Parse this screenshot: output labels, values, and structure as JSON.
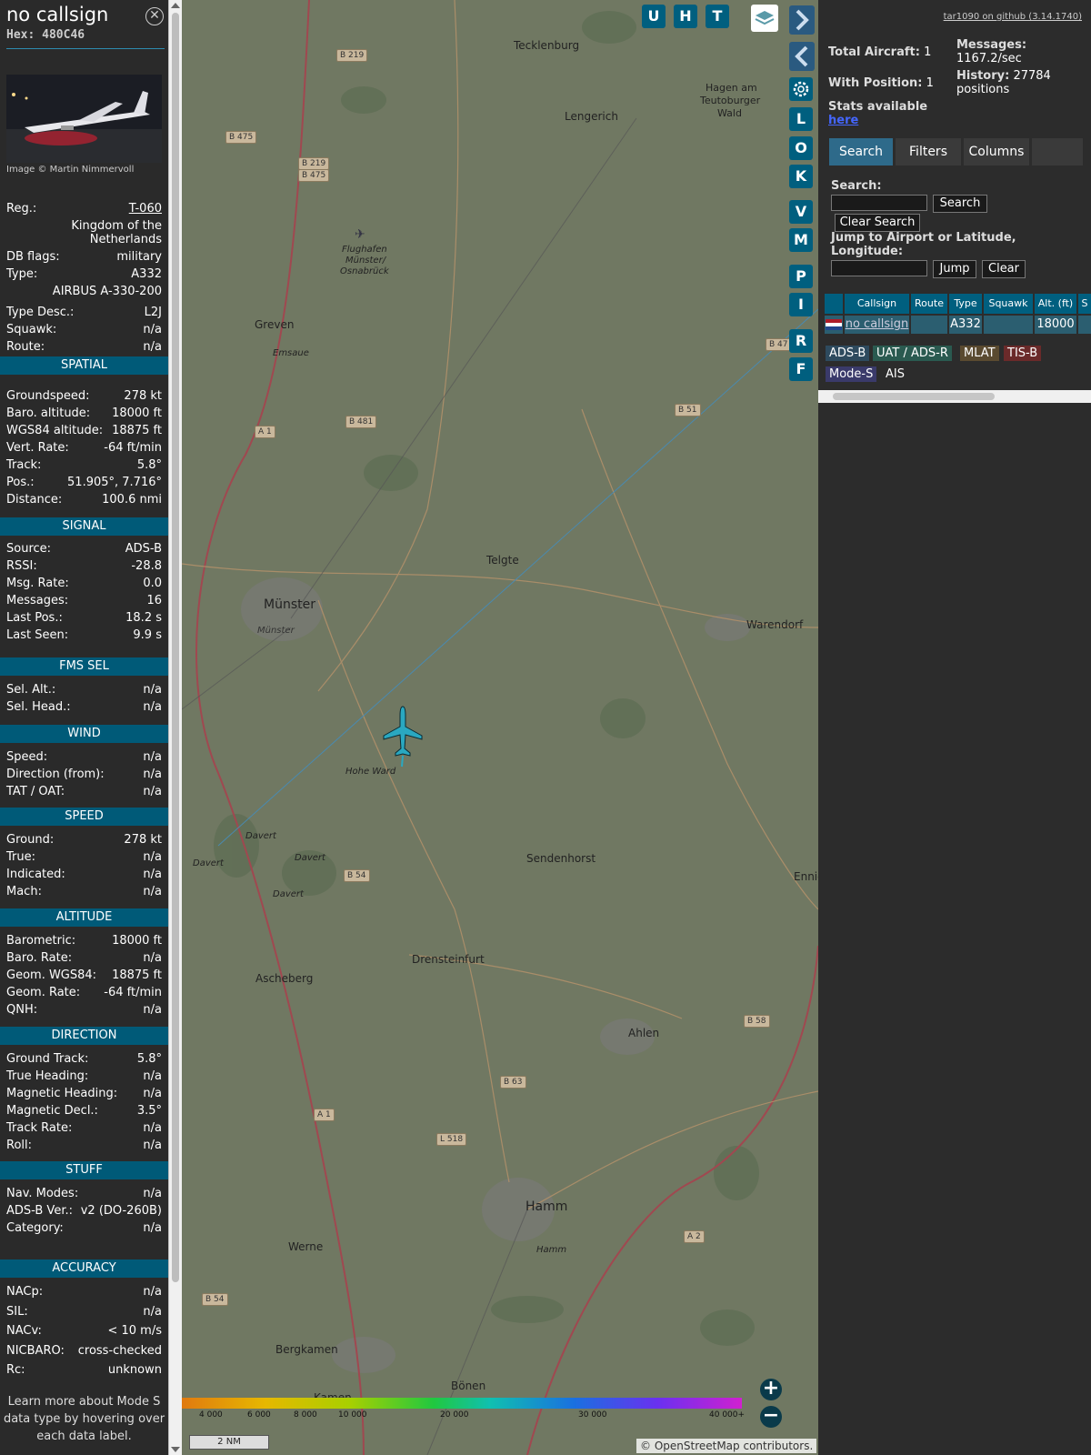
{
  "sidebar": {
    "title": "no callsign",
    "hex_label": "Hex:",
    "hex_value": "480C46",
    "close_icon": "close-icon",
    "photo_credit": "Image © Martin Nimmervoll",
    "top_rows": [
      {
        "k": "Reg.:",
        "v": "T-060"
      },
      {
        "k": "",
        "v": "Kingdom of the"
      },
      {
        "k": "",
        "v": "Netherlands"
      },
      {
        "k": "DB flags:",
        "v": "military"
      },
      {
        "k": "Type:",
        "v": "A332"
      },
      {
        "k": "",
        "v": "AIRBUS A-330-200"
      },
      {
        "k": "Type Desc.:",
        "v": "L2J"
      },
      {
        "k": "Squawk:",
        "v": "n/a"
      },
      {
        "k": "Route:",
        "v": "n/a"
      }
    ],
    "sections": [
      {
        "title": "SPATIAL",
        "rows": [
          {
            "k": "Groundspeed:",
            "v": "278 kt"
          },
          {
            "k": "Baro. altitude:",
            "v": "18000 ft"
          },
          {
            "k": "WGS84 altitude:",
            "v": "18875 ft"
          },
          {
            "k": "Vert. Rate:",
            "v": "-64 ft/min"
          },
          {
            "k": "Track:",
            "v": "5.8°"
          },
          {
            "k": "Pos.:",
            "v": "51.905°, 7.716°"
          },
          {
            "k": "Distance:",
            "v": "100.6 nmi"
          }
        ]
      },
      {
        "title": "SIGNAL",
        "rows": [
          {
            "k": "Source:",
            "v": "ADS-B"
          },
          {
            "k": "RSSI:",
            "v": "-28.8"
          },
          {
            "k": "Msg. Rate:",
            "v": "0.0"
          },
          {
            "k": "Messages:",
            "v": "16"
          },
          {
            "k": "Last Pos.:",
            "v": "18.2 s"
          },
          {
            "k": "Last Seen:",
            "v": "9.9 s"
          }
        ]
      },
      {
        "title": "FMS SEL",
        "rows": [
          {
            "k": "Sel. Alt.:",
            "v": "n/a"
          },
          {
            "k": "Sel. Head.:",
            "v": "n/a"
          }
        ]
      },
      {
        "title": "WIND",
        "rows": [
          {
            "k": "Speed:",
            "v": "n/a"
          },
          {
            "k": "Direction (from):",
            "v": "n/a"
          },
          {
            "k": "TAT / OAT:",
            "v": "n/a"
          }
        ]
      },
      {
        "title": "SPEED",
        "rows": [
          {
            "k": "Ground:",
            "v": "278 kt"
          },
          {
            "k": "True:",
            "v": "n/a"
          },
          {
            "k": "Indicated:",
            "v": "n/a"
          },
          {
            "k": "Mach:",
            "v": "n/a"
          }
        ]
      },
      {
        "title": "ALTITUDE",
        "rows": [
          {
            "k": "Barometric:",
            "v": "18000 ft"
          },
          {
            "k": "Baro. Rate:",
            "v": "n/a"
          },
          {
            "k": "Geom. WGS84:",
            "v": "18875 ft"
          },
          {
            "k": "Geom. Rate:",
            "v": "-64 ft/min"
          },
          {
            "k": "QNH:",
            "v": "n/a"
          }
        ]
      },
      {
        "title": "DIRECTION",
        "rows": [
          {
            "k": "Ground Track:",
            "v": "5.8°"
          },
          {
            "k": "True Heading:",
            "v": "n/a"
          },
          {
            "k": "Magnetic Heading:",
            "v": "n/a"
          },
          {
            "k": "Magnetic Decl.:",
            "v": "3.5°"
          },
          {
            "k": "Track Rate:",
            "v": "n/a"
          },
          {
            "k": "Roll:",
            "v": "n/a"
          }
        ]
      },
      {
        "title": "STUFF",
        "rows": [
          {
            "k": "Nav. Modes:",
            "v": "n/a"
          },
          {
            "k": "ADS-B Ver.:",
            "v": "v2 (DO-260B)"
          },
          {
            "k": "Category:",
            "v": "n/a"
          }
        ]
      },
      {
        "title": "ACCURACY",
        "rows": [
          {
            "k": "NACp:",
            "v": "n/a"
          },
          {
            "k": "SIL:",
            "v": "n/a"
          },
          {
            "k": "NACv:",
            "v": "< 10 m/s"
          },
          {
            "k": "NICBARO:",
            "v": "cross-checked"
          },
          {
            "k": "Rc:",
            "v": "unknown"
          }
        ]
      }
    ],
    "learn_more": "Learn more about Mode S data type by hovering over each data label."
  },
  "map": {
    "top_buttons": [
      "U",
      "H",
      "T"
    ],
    "side_buttons": [
      "L",
      "O",
      "K",
      "V",
      "M",
      "P",
      "I",
      "R",
      "F"
    ],
    "labels": {
      "tecklenburg": "Tecklenburg",
      "lengerich": "Lengerich",
      "hagen1": "Hagen am",
      "hagen2": "Teutoburger",
      "hagen3": "Wald",
      "greven": "Greven",
      "emsaue": "Emsaue",
      "flughafen1": "Flughafen",
      "flughafen2": "Münster/",
      "flughafen3": "Osnabrück",
      "telgte": "Telgte",
      "munster": "Münster",
      "munster_small": "Münster",
      "warendorf": "Warendorf",
      "hohe_ward": "Hohe Ward",
      "sendenhorst": "Sendenhorst",
      "ennig": "Ennig",
      "davert1": "Davert",
      "davert2": "Davert",
      "davert3": "Davert",
      "davert4": "Davert",
      "drensteinfurt": "Drensteinfurt",
      "ascheberg": "Ascheberg",
      "ahlen": "Ahlen",
      "hamm": "Hamm",
      "hamm_small": "Hamm",
      "werne": "Werne",
      "bergkamen": "Bergkamen",
      "bonen": "Bönen",
      "kamen": "Kamen"
    },
    "roads": [
      "B 219",
      "B 475",
      "B 219",
      "B 475",
      "B 481",
      "A 1",
      "B 51",
      "B 54",
      "B 58",
      "B 63",
      "A 1",
      "L 518",
      "A 2",
      "B 54",
      "B 47"
    ],
    "legend_ticks": [
      "4 000",
      "6 000",
      "8 000",
      "10 000",
      "20 000",
      "30 000",
      "40 000+"
    ],
    "scale_label": "2 NM",
    "osm_attr": "© OpenStreetMap contributors."
  },
  "right": {
    "github_link": "tar1090 on github (3.14.1740)",
    "total_aircraft_label": "Total Aircraft:",
    "total_aircraft": "1",
    "with_position_label": "With Position:",
    "with_position": "1",
    "messages_label": "Messages:",
    "messages_value": "1167.2/sec",
    "history_label": "History:",
    "history_value": "27784 positions",
    "stats_label": "Stats available",
    "stats_link": "here",
    "tabs": [
      "Search",
      "Filters",
      "Columns"
    ],
    "search_label": "Search:",
    "search_button": "Search",
    "clear_search_button": "Clear Search",
    "jump_label": "Jump to Airport or Latitude, Longitude:",
    "jump_button": "Jump",
    "clear_button": "Clear",
    "table_headers": [
      "Callsign",
      "Route",
      "Type",
      "Squawk",
      "Alt. (ft)",
      "S"
    ],
    "table_row": {
      "callsign": "no callsign",
      "route": "",
      "type": "A332",
      "squawk": "",
      "alt": "18000"
    },
    "sources": [
      {
        "label": "ADS-B",
        "color": "#2e4a5e"
      },
      {
        "label": "UAT / ADS-R",
        "color": "#2a5a50"
      },
      {
        "label": "MLAT",
        "color": "#5a4a30"
      },
      {
        "label": "TIS-B",
        "color": "#6a2a2a"
      },
      {
        "label": "Mode-S",
        "color": "#3a3a6a"
      },
      {
        "label": "AIS",
        "color": "#2c2c2c"
      }
    ]
  }
}
